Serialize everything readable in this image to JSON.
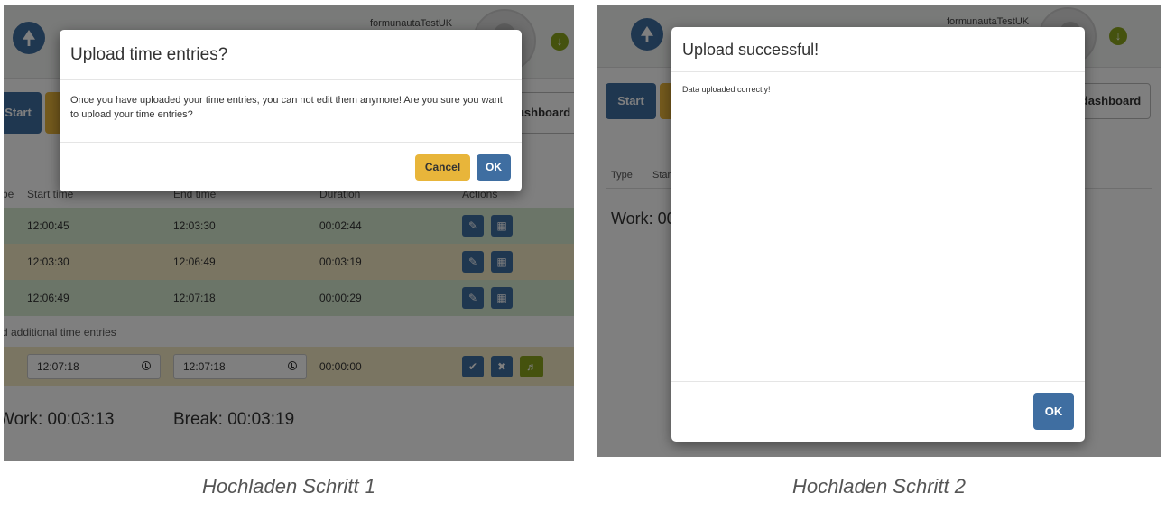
{
  "step1": {
    "user_name": "formunautaTestUK",
    "buttons": {
      "start": "Start",
      "dashboard": "dashboard"
    },
    "table": {
      "headers": [
        "pe",
        "Start time",
        "End time",
        "Duration",
        "Actions"
      ],
      "rows": [
        {
          "start": "12:00:45",
          "end": "12:03:30",
          "duration": "00:02:44"
        },
        {
          "start": "12:03:30",
          "end": "12:06:49",
          "duration": "00:03:19"
        },
        {
          "start": "12:06:49",
          "end": "12:07:18",
          "duration": "00:00:29"
        }
      ]
    },
    "add_section_label": "d additional time entries",
    "new_entry": {
      "start": "12:07:18",
      "end": "12:07:18",
      "duration": "00:00:00"
    },
    "summary": {
      "work": "Work: 00:03:13",
      "break": "Break: 00:03:19"
    },
    "modal": {
      "title": "Upload time entries?",
      "message": "Once you have uploaded your time entries, you can not edit them anymore! Are you sure you want to upload your time entries?",
      "cancel_label": "Cancel",
      "ok_label": "OK"
    },
    "caption": "Hochladen Schritt 1"
  },
  "step2": {
    "user_name": "formunautaTestUK",
    "buttons": {
      "start": "Start",
      "dashboard": "dashboard"
    },
    "table": {
      "headers": [
        "Type",
        "Star"
      ]
    },
    "summary": {
      "work": "Work: 00"
    },
    "modal": {
      "title": "Upload successful!",
      "message": "Data uploaded correctly!",
      "ok_label": "OK"
    },
    "caption": "Hochladen Schritt 2"
  },
  "colors": {
    "primary": "#3f6ea1",
    "warning": "#e8b53a",
    "success": "#8aa41c",
    "row_green": "#d6ead1",
    "row_yellow": "#f5ebc4"
  },
  "icons": {
    "logo": "rocket-icon",
    "user_menu": "chevron-down-circle-icon",
    "edit": "pencil-icon",
    "delete": "trash-icon",
    "confirm": "check-icon",
    "cancel": "close-icon",
    "break": "megaphone-icon",
    "clock": "clock-icon"
  }
}
